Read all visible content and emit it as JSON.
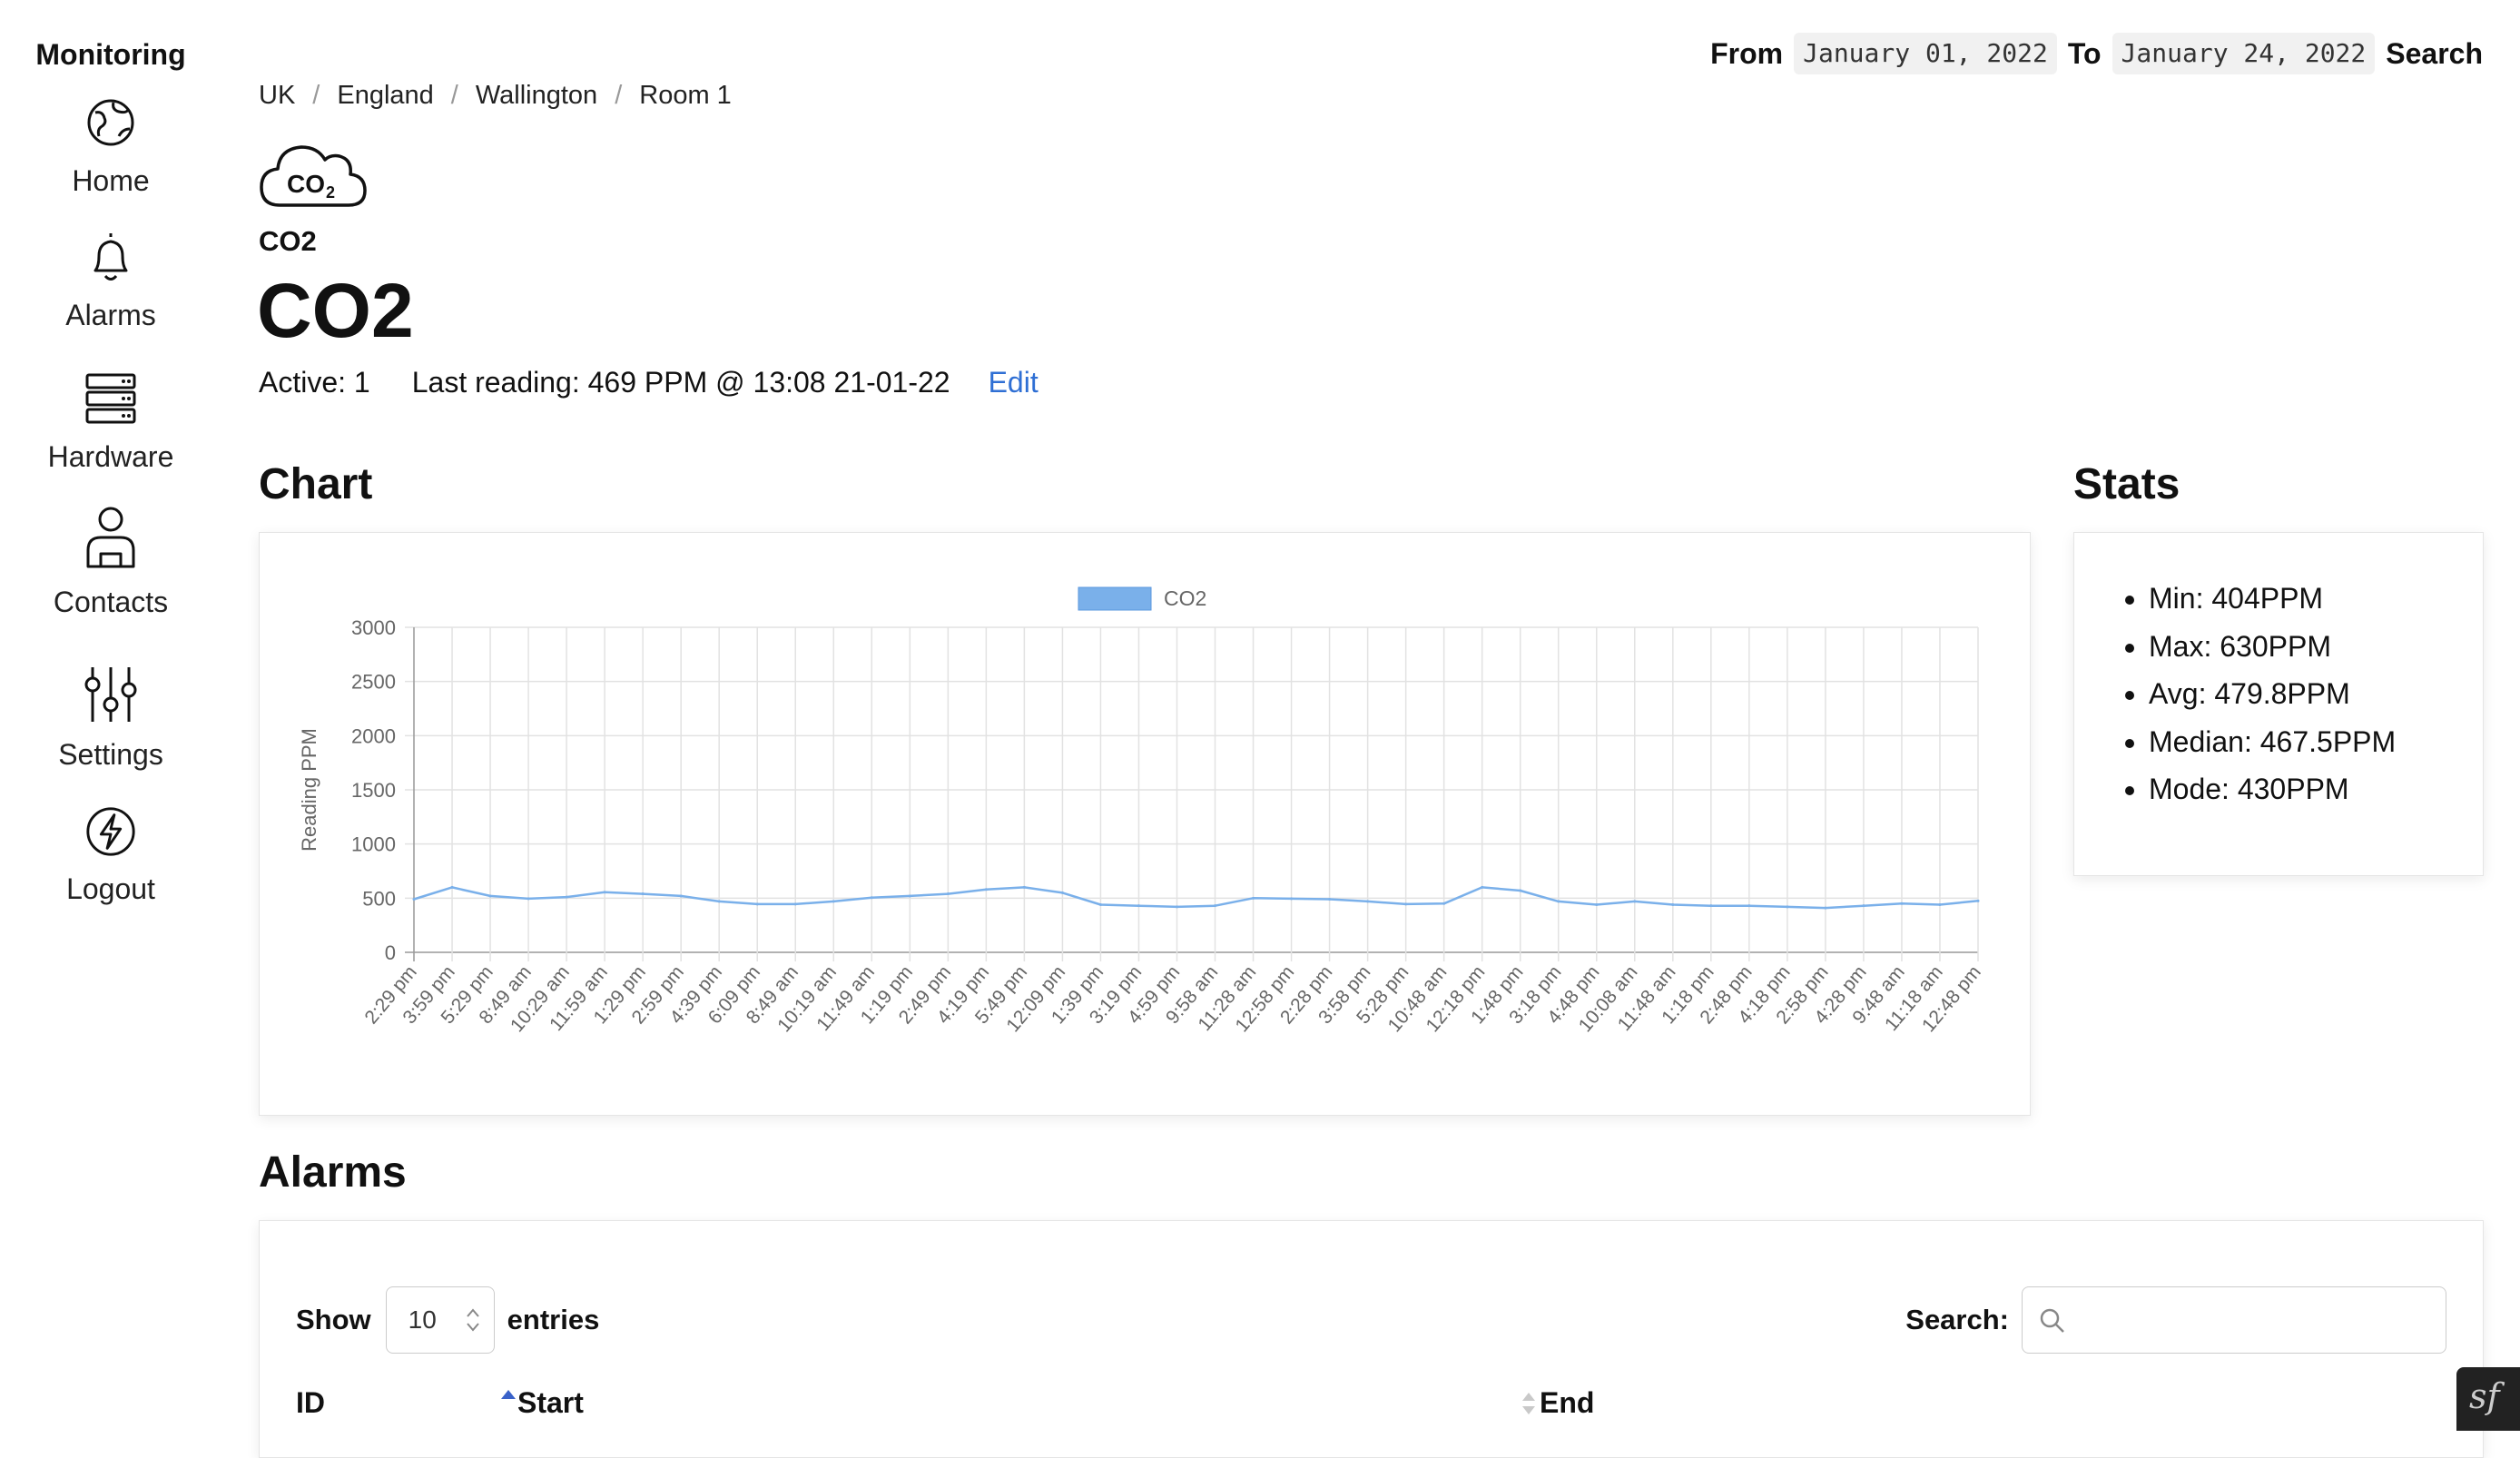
{
  "app": {
    "brand": "Monitoring"
  },
  "sidebar": {
    "items": [
      {
        "label": "Home",
        "icon": "globe-icon"
      },
      {
        "label": "Alarms",
        "icon": "bell-icon"
      },
      {
        "label": "Hardware",
        "icon": "server-icon"
      },
      {
        "label": "Contacts",
        "icon": "user-icon"
      },
      {
        "label": "Settings",
        "icon": "sliders-icon"
      },
      {
        "label": "Logout",
        "icon": "lightning-icon"
      }
    ]
  },
  "topbar": {
    "from_label": "From",
    "from_value": "January 01, 2022",
    "to_label": "To",
    "to_value": "January 24, 2022",
    "search_label": "Search"
  },
  "breadcrumb": [
    "UK",
    "England",
    "Wallington",
    "Room 1"
  ],
  "sensor": {
    "icon": "co2-cloud-icon",
    "icon_text": "CO",
    "icon_subscript": "2",
    "type_label": "CO2",
    "title": "CO2",
    "active": "Active: 1",
    "last_reading": "Last reading: 469 PPM @ 13:08 21-01-22",
    "edit_label": "Edit"
  },
  "sections": {
    "chart": "Chart",
    "stats": "Stats",
    "alarms": "Alarms"
  },
  "stats": [
    "Min: 404PPM",
    "Max: 630PPM",
    "Avg: 479.8PPM",
    "Median: 467.5PPM",
    "Mode: 430PPM"
  ],
  "alarms_table": {
    "show_label": "Show",
    "page_size": "10",
    "entries_label": "entries",
    "search_label": "Search:",
    "search_value": "",
    "columns": [
      "ID",
      "Start",
      "End"
    ]
  },
  "colors": {
    "series": "#7ab0ea",
    "link": "#2f6fd4",
    "sort_active": "#3a62c9"
  },
  "chart_data": {
    "type": "line",
    "title": "",
    "ylabel": "Reading PPM",
    "ylim": [
      0,
      3000
    ],
    "yticks": [
      0,
      500,
      1000,
      1500,
      2000,
      2500,
      3000
    ],
    "grid": true,
    "legend_position": "top",
    "x": [
      "2:29 pm",
      "3:59 pm",
      "5:29 pm",
      "8:49 am",
      "10:29 am",
      "11:59 am",
      "1:29 pm",
      "2:59 pm",
      "4:39 pm",
      "6:09 pm",
      "8:49 am",
      "10:19 am",
      "11:49 am",
      "1:19 pm",
      "2:49 pm",
      "4:19 pm",
      "5:49 pm",
      "12:09 pm",
      "1:39 pm",
      "3:19 pm",
      "4:59 pm",
      "9:58 am",
      "11:28 am",
      "12:58 pm",
      "2:28 pm",
      "3:58 pm",
      "5:28 pm",
      "10:48 am",
      "12:18 pm",
      "1:48 pm",
      "3:18 pm",
      "4:48 pm",
      "10:08 am",
      "11:48 am",
      "1:18 pm",
      "2:48 pm",
      "4:18 pm",
      "2:58 pm",
      "4:28 pm",
      "9:48 am",
      "11:18 am",
      "12:48 pm"
    ],
    "series": [
      {
        "name": "CO2",
        "values": [
          490,
          600,
          520,
          495,
          510,
          555,
          540,
          520,
          470,
          445,
          445,
          470,
          505,
          520,
          540,
          580,
          600,
          550,
          440,
          430,
          420,
          430,
          500,
          495,
          490,
          470,
          445,
          450,
          600,
          570,
          470,
          440,
          470,
          440,
          430,
          430,
          420,
          410,
          430,
          450,
          440,
          475
        ]
      }
    ]
  }
}
